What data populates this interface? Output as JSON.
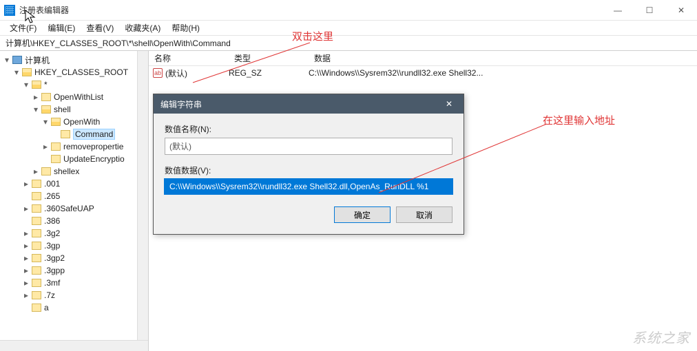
{
  "window": {
    "title": "注册表编辑器",
    "min": "—",
    "max": "☐",
    "close": "✕"
  },
  "menu": {
    "file": "文件(F)",
    "edit": "编辑(E)",
    "view": "查看(V)",
    "fav": "收藏夹(A)",
    "help": "帮助(H)"
  },
  "address": "计算机\\HKEY_CLASSES_ROOT\\*\\shell\\OpenWith\\Command",
  "tree": {
    "root": "计算机",
    "hkcr": "HKEY_CLASSES_ROOT",
    "star": "*",
    "openwithlist": "OpenWithList",
    "shell": "shell",
    "openwith": "OpenWith",
    "command": "Command",
    "removeprop": "removepropertie",
    "updateenc": "UpdateEncryptio",
    "shellex": "shellex",
    "n001": ".001",
    "n265": ".265",
    "n360": ".360SafeUAP",
    "n386": ".386",
    "n3g2": ".3g2",
    "n3gp": ".3gp",
    "n3gp2": ".3gp2",
    "n3gpp": ".3gpp",
    "n3mf": ".3mf",
    "n7z": ".7z",
    "na": "a"
  },
  "list": {
    "hdr_name": "名称",
    "hdr_type": "类型",
    "hdr_data": "数据",
    "row_icon": "ab",
    "row_name": "(默认)",
    "row_type": "REG_SZ",
    "row_data": "C:\\\\Windows\\\\Sysrem32\\\\rundll32.exe Shell32..."
  },
  "dialog": {
    "title": "编辑字符串",
    "close": "✕",
    "name_label": "数值名称(N):",
    "name_value": "(默认)",
    "data_label": "数值数据(V):",
    "data_value": "C:\\\\Windows\\\\Sysrem32\\\\rundll32.exe Shell32.dll,OpenAs_RunDLL %1",
    "ok": "确定",
    "cancel": "取消"
  },
  "annotations": {
    "a1": "双击这里",
    "a2": "在这里输入地址"
  },
  "watermark": "系统之家"
}
